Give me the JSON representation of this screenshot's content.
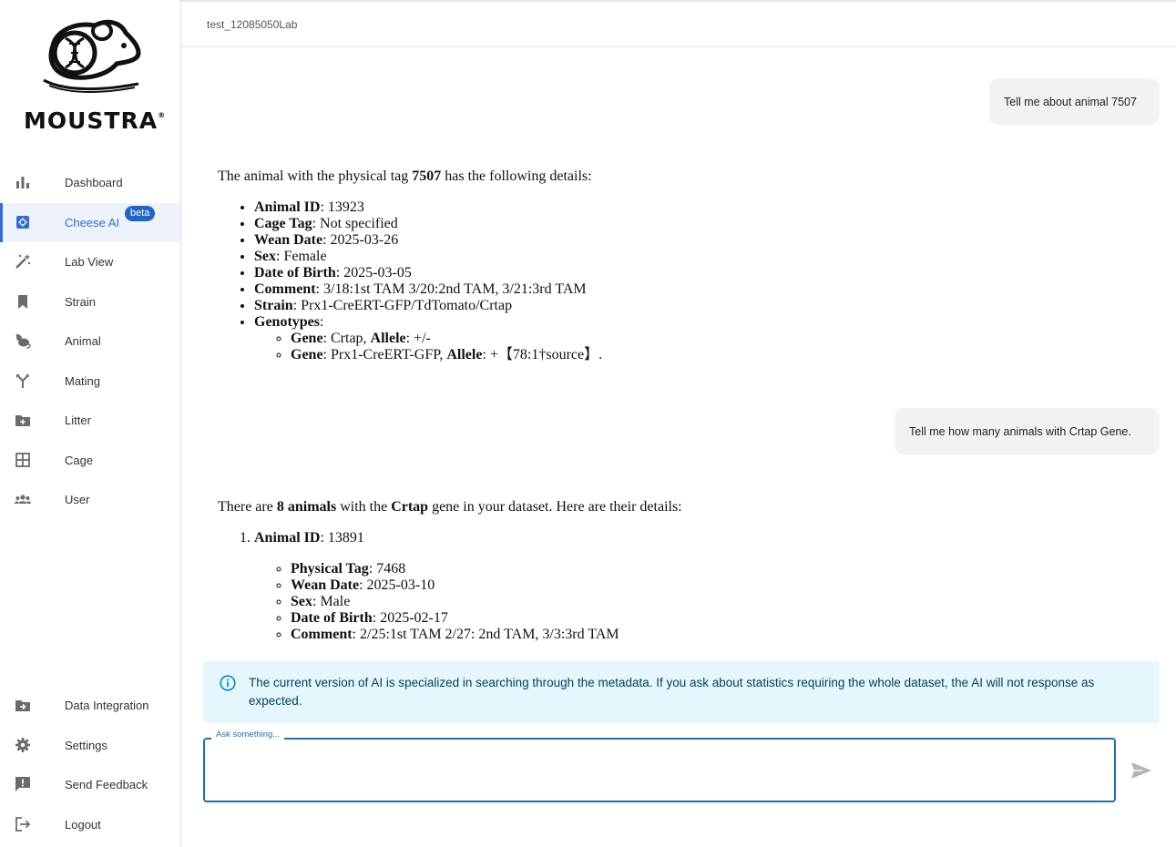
{
  "brand": {
    "name": "MOUSTRA",
    "trademark": "®"
  },
  "header": {
    "lab_name": "test_12085050Lab"
  },
  "sidebar": {
    "items": [
      {
        "label": "Dashboard",
        "icon": "bar-chart-icon"
      },
      {
        "label": "Cheese AI",
        "icon": "ai-chip-icon",
        "badge": "beta",
        "active": true
      },
      {
        "label": "Lab View",
        "icon": "magic-wand-icon"
      },
      {
        "label": "Strain",
        "icon": "bookmark-icon"
      },
      {
        "label": "Animal",
        "icon": "rodent-icon"
      },
      {
        "label": "Mating",
        "icon": "merge-icon"
      },
      {
        "label": "Litter",
        "icon": "folder-add-icon"
      },
      {
        "label": "Cage",
        "icon": "grid-icon"
      },
      {
        "label": "User",
        "icon": "users-icon"
      }
    ],
    "bottom_items": [
      {
        "label": "Data Integration",
        "icon": "folder-import-icon"
      },
      {
        "label": "Settings",
        "icon": "gear-icon"
      },
      {
        "label": "Send Feedback",
        "icon": "feedback-icon"
      },
      {
        "label": "Logout",
        "icon": "logout-icon"
      }
    ]
  },
  "chat": {
    "user_1": "Tell me about animal 7507",
    "ai_1": {
      "intro_pre": "The animal with the physical tag ",
      "intro_bold": "7507",
      "intro_post": " has the following details:",
      "fields": [
        {
          "key": "Animal ID",
          "value": ": 13923"
        },
        {
          "key": "Cage Tag",
          "value": ": Not specified"
        },
        {
          "key": "Wean Date",
          "value": ": 2025-03-26"
        },
        {
          "key": "Sex",
          "value": ": Female"
        },
        {
          "key": "Date of Birth",
          "value": ": 2025-03-05"
        },
        {
          "key": "Comment",
          "value": ": 3/18:1st TAM 3/20:2nd TAM, 3/21:3rd TAM"
        },
        {
          "key": "Strain",
          "value": ": Prx1-CreERT-GFP/TdTomato/Crtap"
        },
        {
          "key": "Genotypes",
          "value": ":"
        }
      ],
      "genotypes": [
        {
          "gene_key": "Gene",
          "gene": ": Crtap, ",
          "allele_key": "Allele",
          "allele": ": +/-"
        },
        {
          "gene_key": "Gene",
          "gene": ": Prx1-CreERT-GFP, ",
          "allele_key": "Allele",
          "allele": ": +【78:1†source】."
        }
      ]
    },
    "user_2": "Tell me how many animals with Crtap Gene.",
    "ai_2": {
      "p1": "There are ",
      "b1": "8 animals",
      "p2": " with the ",
      "b2": "Crtap",
      "p3": " gene in your dataset. Here are their details:",
      "item_key": "Animal ID",
      "item_value": ": 13891",
      "sub": [
        {
          "key": "Physical Tag",
          "value": ": 7468"
        },
        {
          "key": "Wean Date",
          "value": ": 2025-03-10"
        },
        {
          "key": "Sex",
          "value": ": Male"
        },
        {
          "key": "Date of Birth",
          "value": ": 2025-02-17"
        },
        {
          "key": "Comment",
          "value": ": 2/25:1st TAM 2/27: 2nd TAM, 3/3:3rd TAM"
        }
      ]
    }
  },
  "alert": {
    "text": "The current version of AI is specialized in searching through the metadata. If you ask about statistics requiring the whole dataset, the AI will not response as expected.",
    "icon": "info-icon",
    "color": "#e5f6fd"
  },
  "input": {
    "label": "Ask something...",
    "value": "",
    "send_icon": "send-icon"
  },
  "colors": {
    "accent": "#2f6fd1",
    "badge": "#1f64c8",
    "input_border": "#1f6fa8"
  }
}
